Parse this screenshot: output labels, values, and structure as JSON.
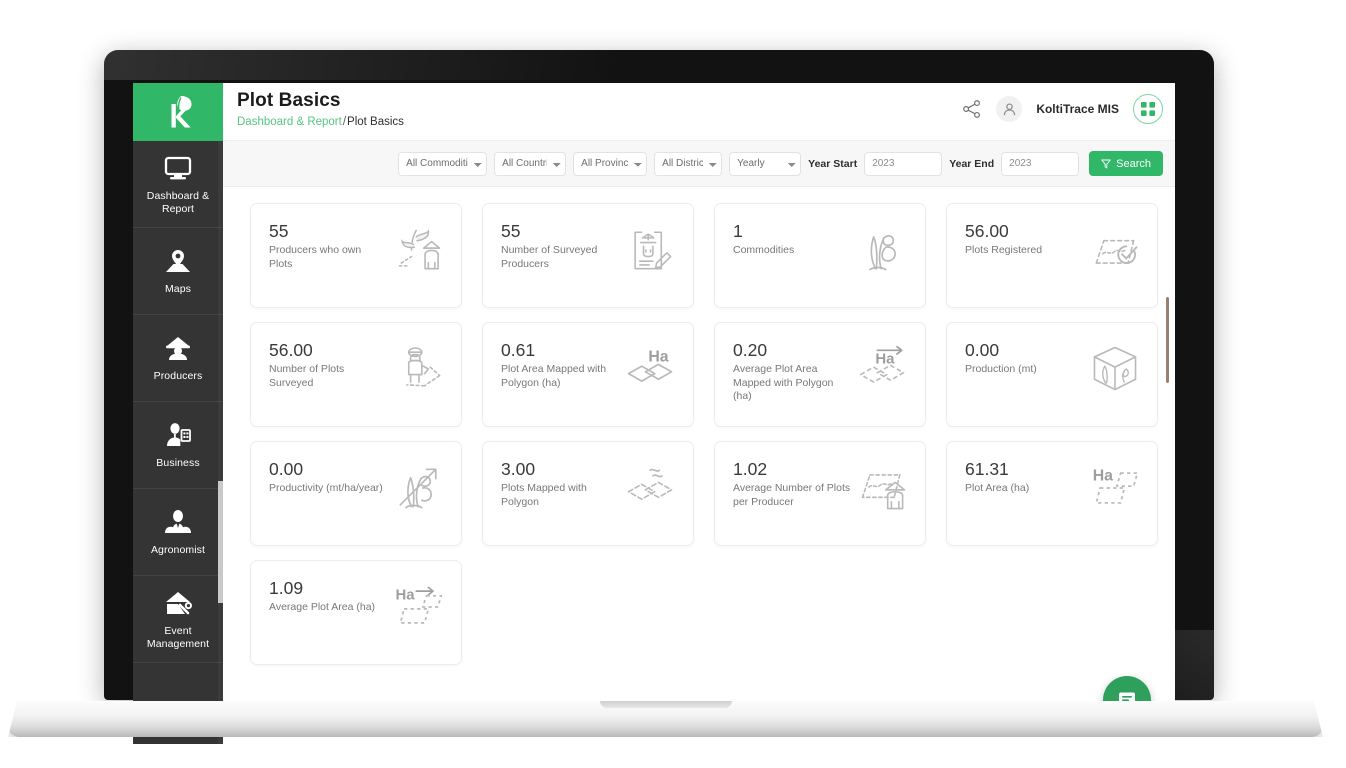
{
  "brand": {
    "logo_icon": "leaf-k-logo",
    "accent_green": "#31b768",
    "sidebar_bg": "#343434"
  },
  "header": {
    "title": "Plot Basics",
    "breadcrumb_link": "Dashboard & Report",
    "breadcrumb_separator": "/",
    "breadcrumb_current": "Plot Basics",
    "user_name": "KoltiTrace MIS",
    "share_icon": "share-icon",
    "avatar_icon": "user-avatar-icon",
    "apps_icon": "grid-apps-icon"
  },
  "sidebar": {
    "items": [
      {
        "label": "Dashboard & Report",
        "icon": "monitor-icon"
      },
      {
        "label": "Maps",
        "icon": "map-pin-icon"
      },
      {
        "label": "Producers",
        "icon": "farmer-icon"
      },
      {
        "label": "Business",
        "icon": "business-person-icon"
      },
      {
        "label": "Agronomist",
        "icon": "agronomist-icon"
      },
      {
        "label": "Event Management",
        "icon": "event-tools-icon"
      }
    ]
  },
  "filters": {
    "commodities": "All Commodities",
    "countries": "All Countries",
    "provinces": "All Provinces",
    "districts": "All Districts",
    "period": "Yearly",
    "year_start_label": "Year Start",
    "year_start_value": "2023",
    "year_end_label": "Year End",
    "year_end_value": "2023",
    "search_label": "Search",
    "search_icon": "filter-funnel-icon"
  },
  "cards": [
    {
      "value": "55",
      "label": "Producers who own Plots",
      "icon": "plant-farmer-icon"
    },
    {
      "value": "55",
      "label": "Number of Surveyed Producers",
      "icon": "clipboard-survey-icon"
    },
    {
      "value": "1",
      "label": "Commodities",
      "icon": "seaweed-icon"
    },
    {
      "value": "56.00",
      "label": "Plots Registered",
      "icon": "plot-check-icon"
    },
    {
      "value": "56.00",
      "label": "Number of Plots Surveyed",
      "icon": "surveyor-icon"
    },
    {
      "value": "0.61",
      "label": "Plot Area Mapped with Polygon (ha)",
      "icon": "ha-polygon-icon"
    },
    {
      "value": "0.20",
      "label": "Average Plot Area Mapped with Polygon (ha)",
      "icon": "ha-arrow-polygon-icon"
    },
    {
      "value": "0.00",
      "label": "Production (mt)",
      "icon": "box-seaweed-icon"
    },
    {
      "value": "0.00",
      "label": "Productivity (mt/ha/year)",
      "icon": "growth-arrow-icon"
    },
    {
      "value": "3.00",
      "label": "Plots Mapped with Polygon",
      "icon": "polygon-waves-icon"
    },
    {
      "value": "1.02",
      "label": "Average Number of Plots per Producer",
      "icon": "plot-farmer-icon"
    },
    {
      "value": "61.31",
      "label": "Plot Area (ha)",
      "icon": "ha-dashed-plot-icon"
    },
    {
      "value": "1.09",
      "label": "Average Plot Area (ha)",
      "icon": "ha-arrow-dashed-icon"
    }
  ],
  "chat": {
    "icon": "chat-bubble-icon"
  }
}
